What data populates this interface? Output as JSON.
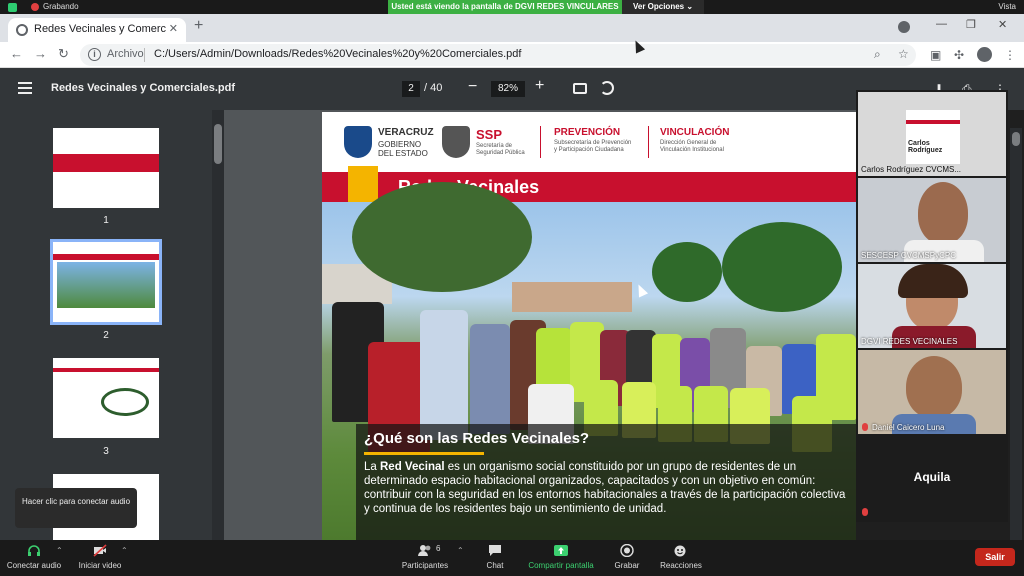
{
  "zoom_top": {
    "recording_label": "Grabando",
    "share_banner": "Usted está viendo la pantalla de DGVI REDES VINCULARES",
    "view_options": "Ver Opciones ⌄",
    "view_label": "Vista"
  },
  "browser": {
    "tab_title": "Redes Vecinales y Comerciales.p",
    "address_label": "Archivo",
    "url": "C:/Users/Admin/Downloads/Redes%20Vecinales%20y%20Comerciales.pdf"
  },
  "pdf_toolbar": {
    "title": "Redes Vecinales y Comerciales.pdf",
    "current_page": "2",
    "total_pages": "/ 40",
    "zoom": "82%"
  },
  "sidebar": {
    "thumbnails": [
      {
        "number": "1"
      },
      {
        "number": "2"
      },
      {
        "number": "3"
      }
    ]
  },
  "slide": {
    "org1_name": "VERACRUZ",
    "org1_sub": "GOBIERNO\nDEL ESTADO",
    "org2_name": "SSP",
    "org2_sub": "Secretaría de\nSeguridad Pública",
    "org3_name": "PREVENCIÓN",
    "org3_sub": "Subsecretaría de Prevención\ny Participación Ciudadana",
    "org4_name": "VINCULACIÓN",
    "org4_sub": "Dirección General de\nVinculación Institucional",
    "banner_title": "Redes Vecinales",
    "question": "¿Qué son las Redes Vecinales?",
    "body_prefix": "La ",
    "body_bold": "Red Vecinal",
    "body_rest": " es un organismo social constituido por un grupo de residentes de un determinado espacio habitacional organizados, capacitados y con un objetivo en común: contribuir con la seguridad en los entornos habitacionales a través de la participación colectiva y continua de los residentes bajo un sentimiento de unidad."
  },
  "participants": [
    {
      "name": "Carlos Rodríguez CVCMS..."
    },
    {
      "name": "SESCESP CVCMSPyCPC"
    },
    {
      "name": "DGVI REDES VECINALES"
    },
    {
      "name": "Daniel Caicero Luna"
    },
    {
      "name": "Aquila"
    }
  ],
  "participant_slide_thumb": {
    "title": "Carlos Rodríguez"
  },
  "zoom_bottom": {
    "audio": "Conectar audio",
    "video": "Iniciar video",
    "participants": "Participantes",
    "participants_count": "6",
    "chat": "Chat",
    "share": "Compartir pantalla",
    "record": "Grabar",
    "reactions": "Reacciones",
    "leave": "Salir",
    "tooltip": "Hacer clic para conectar audio"
  },
  "colors": {
    "accent_red": "#c8102e",
    "accent_yellow": "#f4b400",
    "zoom_green": "#3cb043"
  }
}
